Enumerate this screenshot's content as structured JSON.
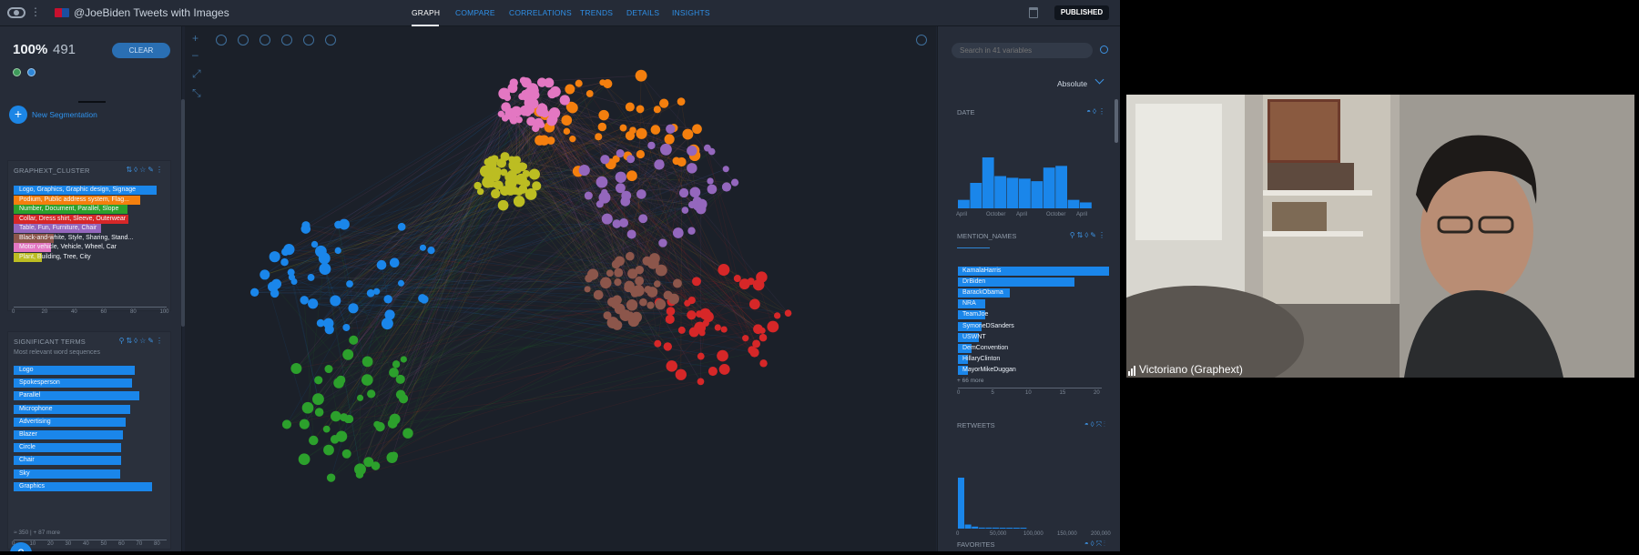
{
  "app": {
    "title": "@JoeBiden Tweets with Images",
    "nav": [
      "GRAPH",
      "COMPARE",
      "CORRELATIONS",
      "TRENDS",
      "DETAILS",
      "INSIGHTS"
    ],
    "active_nav": "GRAPH",
    "published_label": "PUBLISHED"
  },
  "left": {
    "percent": "100%",
    "count": "491",
    "clear_label": "CLEAR",
    "new_segmentation": "New Segmentation",
    "cluster_card": {
      "title": "GRAPHEXT_CLUSTER",
      "items": [
        {
          "label": "Logo, Graphics, Graphic design, Signage",
          "value": 97,
          "color": "#1a86ea"
        },
        {
          "label": "Podium, Public address system, Flag...",
          "value": 86,
          "color": "#f47f0e"
        },
        {
          "label": "Number, Document, Parallel, Slope",
          "value": 77,
          "color": "#2ca02c"
        },
        {
          "label": "Collar, Dress shirt, Sleeve, Outerwear",
          "value": 78,
          "color": "#d62728"
        },
        {
          "label": "Table, Fun, Furniture, Chair",
          "value": 59,
          "color": "#9467bd"
        },
        {
          "label": "Black-and-white, Style, Sharing, Stand...",
          "value": 27,
          "color": "#8c564b"
        },
        {
          "label": "Motor vehicle, Vehicle, Wheel, Car",
          "value": 25,
          "color": "#e377c2"
        },
        {
          "label": "Plant, Building, Tree, City",
          "value": 19,
          "color": "#bcbd22"
        }
      ],
      "axis": [
        "0",
        "20",
        "40",
        "60",
        "80",
        "100"
      ]
    },
    "terms_card": {
      "title": "SIGNIFICANT TERMS",
      "subtitle": "Most relevant word sequences",
      "items": [
        {
          "label": "Logo",
          "value": 82
        },
        {
          "label": "Spokesperson",
          "value": 80
        },
        {
          "label": "Parallel",
          "value": 85
        },
        {
          "label": "Microphone",
          "value": 79
        },
        {
          "label": "Advertising",
          "value": 76
        },
        {
          "label": "Blazer",
          "value": 74
        },
        {
          "label": "Circle",
          "value": 73
        },
        {
          "label": "Chair",
          "value": 73
        },
        {
          "label": "Sky",
          "value": 72
        },
        {
          "label": "Graphics",
          "value": 94
        }
      ],
      "note": "≈ 350  |  + 87 more",
      "axis": [
        "0",
        "10",
        "20",
        "30",
        "40",
        "50",
        "60",
        "70",
        "80"
      ]
    },
    "help_label": "?"
  },
  "right": {
    "search_placeholder": "Search in 41 variables",
    "scale_mode": "Absolute",
    "date": {
      "title": "DATE",
      "values": [
        10,
        30,
        60,
        38,
        36,
        35,
        32,
        48,
        50,
        10,
        7
      ],
      "ticks": [
        "April",
        "October",
        "April",
        "October",
        "April"
      ]
    },
    "mentions": {
      "title": "MENTION_NAMES",
      "items": [
        {
          "label": "KamalaHarris",
          "value": 22
        },
        {
          "label": "DrBiden",
          "value": 17
        },
        {
          "label": "BarackObama",
          "value": 7.5
        },
        {
          "label": "NRA",
          "value": 4
        },
        {
          "label": "TeamJoe",
          "value": 4
        },
        {
          "label": "SymoneDSanders",
          "value": 3.5
        },
        {
          "label": "USWNT",
          "value": 3
        },
        {
          "label": "DemConvention",
          "value": 2
        },
        {
          "label": "HillaryClinton",
          "value": 1.5
        },
        {
          "label": "MayorMikeDuggan",
          "value": 1.5
        }
      ],
      "more": "+ 66 more",
      "ticks": [
        "0",
        "5",
        "10",
        "15",
        "20"
      ]
    },
    "retweets": {
      "title": "RETWEETS",
      "values": [
        50,
        4,
        2,
        1,
        1,
        1,
        0.5,
        0.5,
        0.3,
        0.3
      ],
      "ticks": [
        "0",
        "50,000",
        "100,000",
        "150,000",
        "200,000"
      ]
    },
    "favorites": {
      "title": "FAVORITES"
    }
  },
  "video": {
    "participant": "Victoriano (Graphext)"
  }
}
